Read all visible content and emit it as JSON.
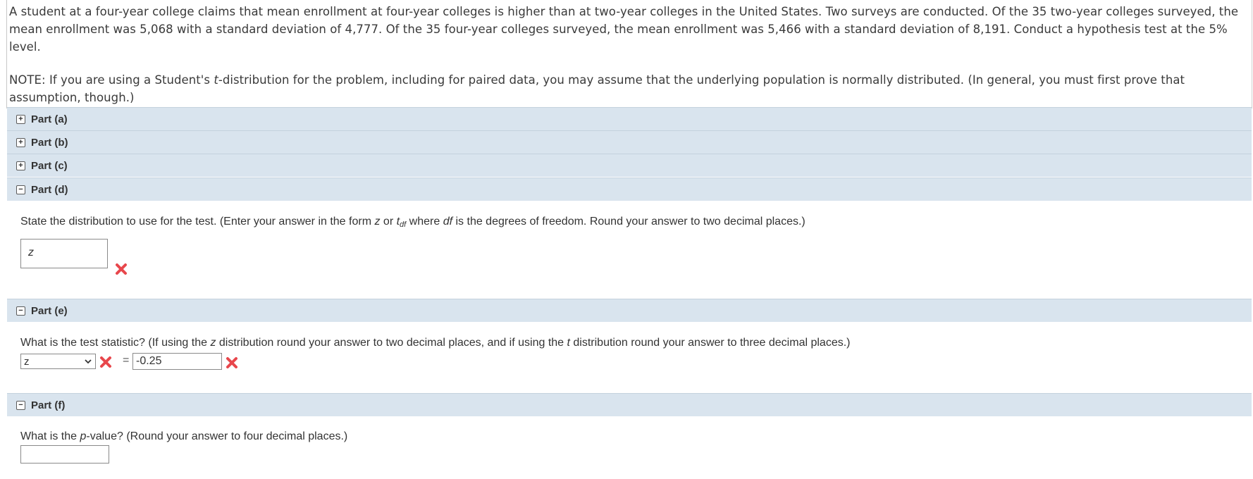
{
  "intro": {
    "problem": "A student at a four-year college claims that mean enrollment at four-year colleges is higher than at two-year colleges in the United States. Two surveys are conducted. Of the 35 two-year colleges surveyed, the mean enrollment was 5,068 with a standard deviation of 4,777. Of the 35 four-year colleges surveyed, the mean enrollment was 5,466 with a standard deviation of 8,191. Conduct a hypothesis test at the 5% level.",
    "note_prefix": "NOTE: If you are using a Student's ",
    "note_t": "t",
    "note_suffix": "-distribution for the problem, including for paired data, you may assume that the underlying population is normally distributed. (In general, you must first prove that assumption, though.)"
  },
  "parts": {
    "a": {
      "label": "Part (a)",
      "expanded": false
    },
    "b": {
      "label": "Part (b)",
      "expanded": false
    },
    "c": {
      "label": "Part (c)",
      "expanded": false
    },
    "d": {
      "label": "Part (d)",
      "expanded": true
    },
    "e": {
      "label": "Part (e)",
      "expanded": true
    },
    "f": {
      "label": "Part (f)",
      "expanded": true
    }
  },
  "icons": {
    "expand": "+",
    "collapse": "−"
  },
  "part_d": {
    "q_1": "State the distribution to use for the test. (Enter your answer in the form ",
    "q_z": "z",
    "q_or": " or ",
    "q_t": "t",
    "q_df": "df",
    "q_2": " where ",
    "q_df2": "df",
    "q_3": " is the degrees of freedom. Round your answer to two decimal places.)",
    "answer": "z",
    "status": "incorrect"
  },
  "part_e": {
    "q_1": "What is the test statistic? (If using the ",
    "q_z": "z",
    "q_2": " distribution round your answer to two decimal places, and if using the ",
    "q_t": "t",
    "q_3": " distribution round your answer to three decimal places.)",
    "select_value": "z",
    "equals": "=",
    "answer": "-0.25",
    "status": "incorrect"
  },
  "part_f": {
    "q_1": "What is the ",
    "q_p": "p",
    "q_2": "-value? (Round your answer to four decimal places.)",
    "answer": ""
  },
  "colors": {
    "header_bg": "#d9e4ee",
    "error": "#e8474c"
  }
}
